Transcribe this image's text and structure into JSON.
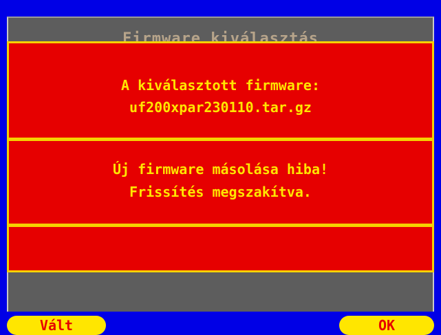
{
  "background": {
    "title": "Firmware kiválasztás"
  },
  "dialog": {
    "selected_label": "A kiválasztott firmware:",
    "selected_file": "uf200xpar230110.tar.gz",
    "error_line1": "Új firmware másolása hiba!",
    "error_line2": "Frissítés megszakítva."
  },
  "softkeys": {
    "left_label": "Vált",
    "right_label": "OK"
  },
  "colors": {
    "frame_blue": "#0000e6",
    "dialog_red": "#e60000",
    "accent_yellow": "#f6d100",
    "panel_gray": "#5d5d5d"
  }
}
